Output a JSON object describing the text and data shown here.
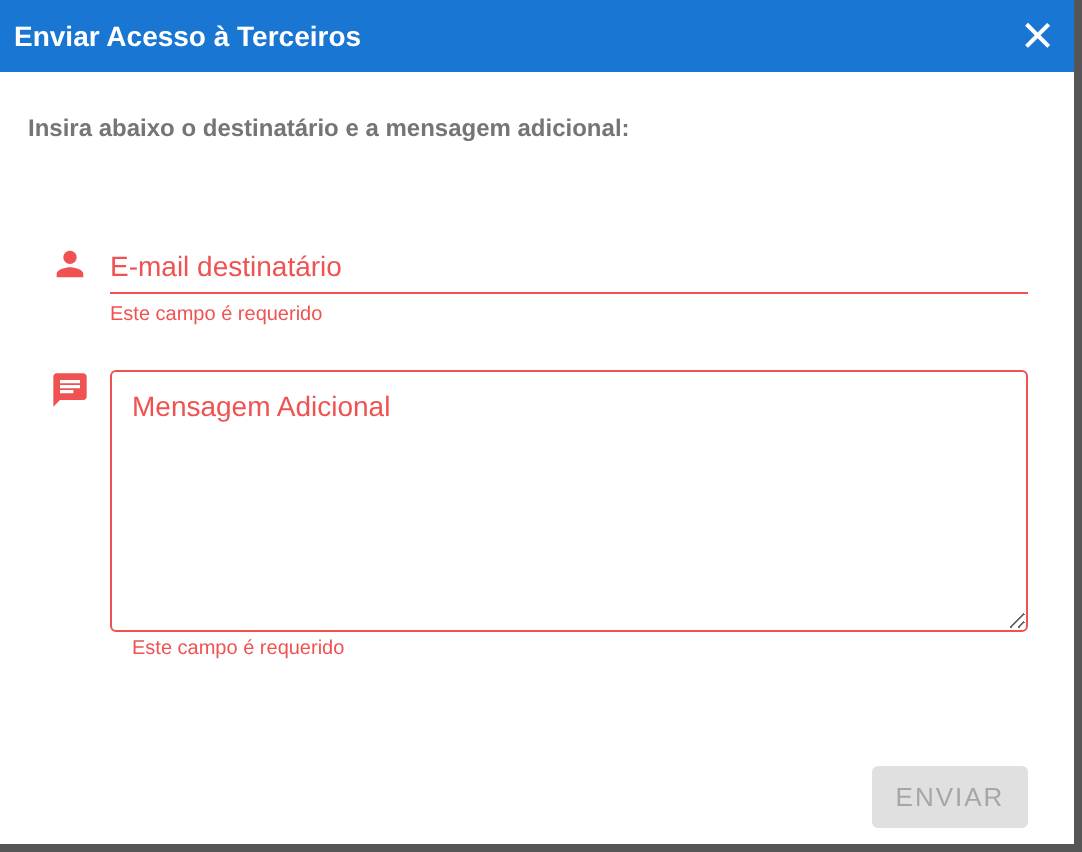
{
  "dialog": {
    "title": "Enviar Acesso à Terceiros",
    "close": "×"
  },
  "instruction": "Insira abaixo o destinatário e a mensagem adicional:",
  "fields": [
    {
      "kind": "line",
      "placeholder": "E-mail destinatário",
      "error": true,
      "error_text": "Este campo é requerido"
    },
    {
      "kind": "area",
      "placeholder": "Mensagem Adicional",
      "error": true,
      "error_text": "Este campo é requerido"
    }
  ],
  "button": {
    "label": "ENVIAR",
    "disabled": true
  }
}
